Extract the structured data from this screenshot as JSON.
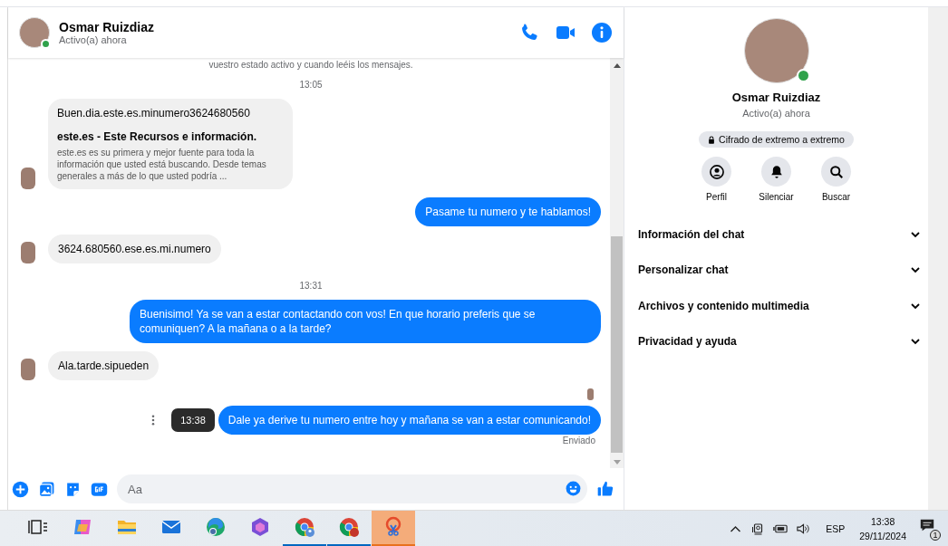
{
  "chat": {
    "name": "Osmar Ruizdiaz",
    "status": "Activo(a) ahora",
    "online": true
  },
  "messages": [
    {
      "kind": "notice",
      "text": "vuestro estado activo y cuando leéis los mensajes."
    },
    {
      "kind": "time",
      "text": "13:05"
    },
    {
      "kind": "link",
      "text": "Buen.dia.este.es.minumero3624680560",
      "title": "este.es - Este Recursos e información.",
      "desc": "este.es es su primera y mejor fuente para toda la información que usted está buscando. Desde temas generales a más de lo que usted podría ..."
    },
    {
      "kind": "outgoing",
      "text": "Pasame tu numero y te hablamos!"
    },
    {
      "kind": "incoming",
      "text": "3624.680560.ese.es.mi.numero"
    },
    {
      "kind": "time",
      "text": "13:31"
    },
    {
      "kind": "outgoing",
      "text": "Buenisimo! Ya se van a estar contactando con vos! En que horario preferis que se comuniquen? A la mañana o a la tarde?"
    },
    {
      "kind": "incoming",
      "text": "Ala.tarde.sipueden"
    },
    {
      "kind": "seen"
    },
    {
      "kind": "outgoing",
      "text": "Dale ya derive tu numero entre hoy y mañana se van a estar comunicando!",
      "tooltip": "13:38",
      "receipt": "Enviado"
    }
  ],
  "composer": {
    "placeholder": "Aa"
  },
  "info": {
    "name": "Osmar Ruizdiaz",
    "status": "Activo(a) ahora",
    "online": true,
    "encryption": "Cifrado de extremo a extremo",
    "actions": [
      {
        "kind": "profile",
        "label": "Perfil"
      },
      {
        "kind": "mute",
        "label": "Silenciar"
      },
      {
        "kind": "search",
        "label": "Buscar"
      }
    ],
    "sections": [
      {
        "label": "Información del chat",
        "expanded": false
      },
      {
        "label": "Personalizar chat",
        "expanded": false
      },
      {
        "label": "Archivos y contenido multimedia",
        "expanded": false
      },
      {
        "label": "Privacidad y ayuda",
        "expanded": false
      }
    ]
  },
  "taskbar": {
    "apps": [
      {
        "kind": "taskview",
        "running": false,
        "selected": false
      },
      {
        "kind": "copilot",
        "running": false,
        "selected": false
      },
      {
        "kind": "folder",
        "running": false,
        "selected": false
      },
      {
        "kind": "mail",
        "running": false,
        "selected": false
      },
      {
        "kind": "edge",
        "running": false,
        "selected": false
      },
      {
        "kind": "hex",
        "running": false,
        "selected": false
      },
      {
        "kind": "chrome",
        "running": true,
        "selected": false
      },
      {
        "kind": "chrome-b",
        "running": true,
        "selected": false
      },
      {
        "kind": "snip",
        "running": true,
        "selected": true
      }
    ],
    "language": "ESP",
    "time": "13:38",
    "date": "29/11/2024",
    "notifications": "1"
  }
}
